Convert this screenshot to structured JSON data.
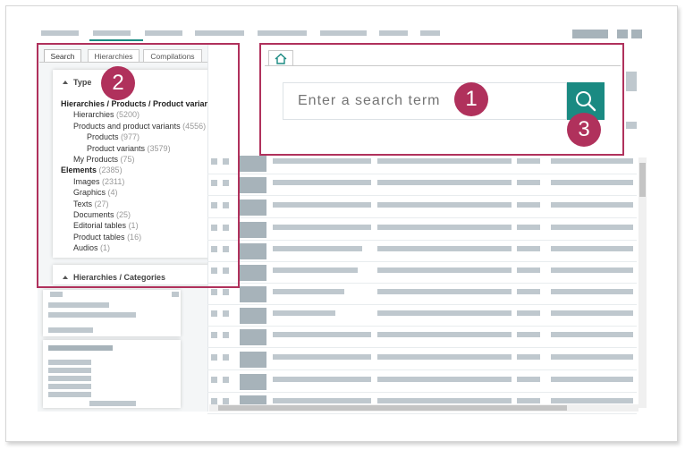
{
  "tabs": [
    {
      "label": "Search",
      "active": true
    },
    {
      "label": "Hierarchies",
      "active": false
    },
    {
      "label": "Compilations",
      "active": false
    }
  ],
  "type_section": {
    "title": "Type",
    "tree": [
      {
        "label": "Hierarchies / Products / Product variants",
        "count": "",
        "bold": true,
        "level": 0
      },
      {
        "label": "Hierarchies",
        "count": "(5200)",
        "bold": false,
        "level": 1
      },
      {
        "label": "Products and product variants",
        "count": "(4556)",
        "bold": false,
        "level": 1
      },
      {
        "label": "Products",
        "count": "(977)",
        "bold": false,
        "level": 2
      },
      {
        "label": "Product variants",
        "count": "(3579)",
        "bold": false,
        "level": 2
      },
      {
        "label": "My Products",
        "count": "(75)",
        "bold": false,
        "level": 1
      },
      {
        "label": "Elements",
        "count": "(2385)",
        "bold": true,
        "level": 0
      },
      {
        "label": "Images",
        "count": "(2311)",
        "bold": false,
        "level": 1
      },
      {
        "label": "Graphics",
        "count": "(4)",
        "bold": false,
        "level": 1
      },
      {
        "label": "Texts",
        "count": "(27)",
        "bold": false,
        "level": 1
      },
      {
        "label": "Documents",
        "count": "(25)",
        "bold": false,
        "level": 1
      },
      {
        "label": "Editorial tables",
        "count": "(1)",
        "bold": false,
        "level": 1
      },
      {
        "label": "Product tables",
        "count": "(16)",
        "bold": false,
        "level": 1
      },
      {
        "label": "Audios",
        "count": "(1)",
        "bold": false,
        "level": 1
      }
    ]
  },
  "categories_section": {
    "title": "Hierarchies / Categories"
  },
  "search": {
    "placeholder": "Enter a search term"
  },
  "callouts": {
    "one": "1",
    "two": "2",
    "three": "3"
  },
  "colors": {
    "accent": "#1a8a82",
    "highlight": "#b0315c",
    "placeholder": "#bfc8ce"
  },
  "icons": {
    "home": "home-icon",
    "search": "search-icon"
  }
}
